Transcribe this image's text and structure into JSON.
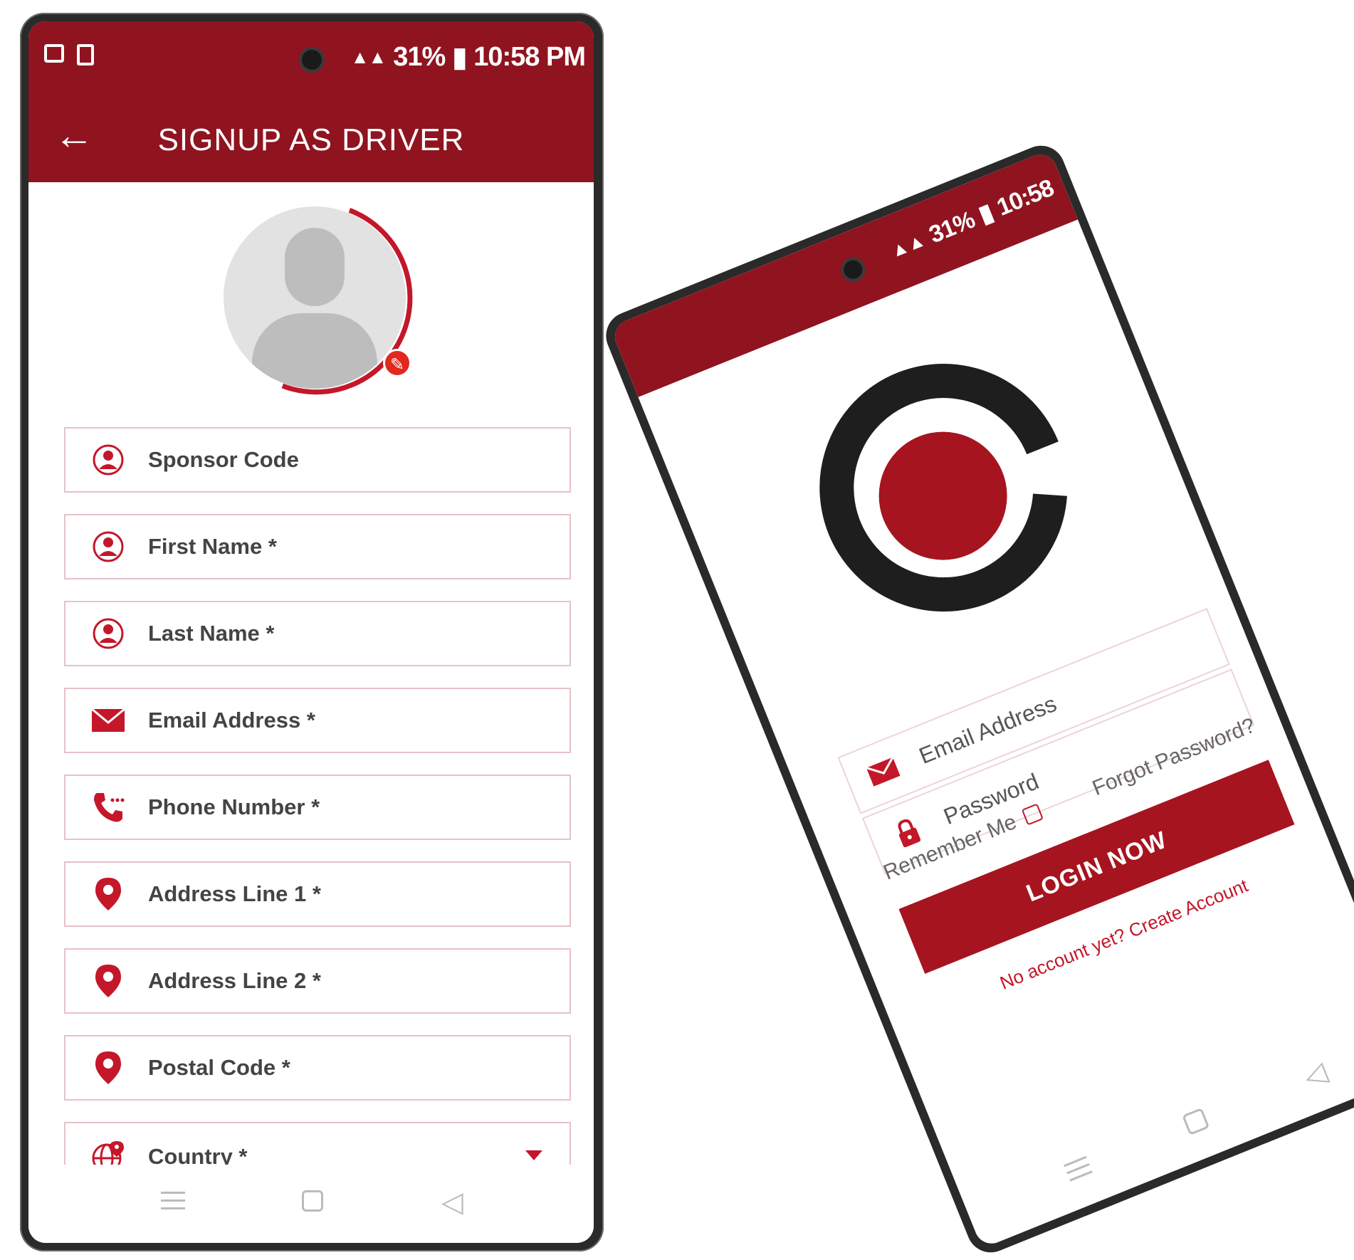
{
  "signup": {
    "status": {
      "battery": "31%",
      "time": "10:58 PM"
    },
    "title": "SIGNUP AS DRIVER",
    "fields": [
      {
        "label": "Sponsor Code",
        "icon": "user-icon"
      },
      {
        "label": "First Name *",
        "icon": "user-icon"
      },
      {
        "label": "Last Name *",
        "icon": "user-icon"
      },
      {
        "label": "Email Address *",
        "icon": "mail-icon"
      },
      {
        "label": "Phone Number *",
        "icon": "phone-icon"
      },
      {
        "label": "Address Line 1 *",
        "icon": "location-pin-icon"
      },
      {
        "label": "Address Line 2 *",
        "icon": "location-pin-icon"
      },
      {
        "label": "Postal Code *",
        "icon": "location-pin-icon"
      },
      {
        "label": "Country *",
        "icon": "globe-icon"
      }
    ]
  },
  "login": {
    "status": {
      "battery": "31%",
      "time": "10:58"
    },
    "email_placeholder": "Email Address",
    "password_placeholder": "Password",
    "remember_label": "Remember Me",
    "forgot_label": "Forgot Password?",
    "login_label": "LOGIN NOW",
    "no_account_label": "No account yet? Create Account"
  },
  "colors": {
    "brand": "#8f1420",
    "accent": "#c4172a",
    "logo_dark": "#1e1e1e"
  }
}
